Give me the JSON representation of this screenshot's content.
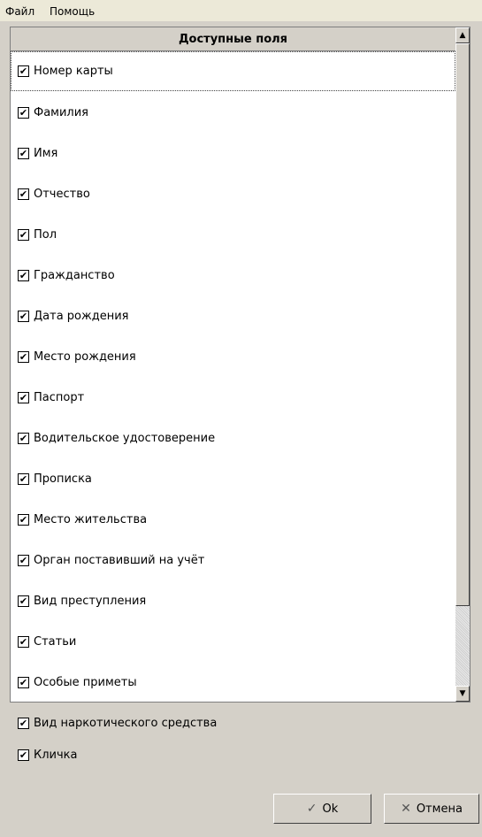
{
  "menu": {
    "file": "Файл",
    "help": "Помощь"
  },
  "list": {
    "header": "Доступные поля",
    "items": [
      {
        "label": "Номер карты",
        "checked": true
      },
      {
        "label": "Фамилия",
        "checked": true
      },
      {
        "label": "Имя",
        "checked": true
      },
      {
        "label": "Отчество",
        "checked": true
      },
      {
        "label": "Пол",
        "checked": true
      },
      {
        "label": "Гражданство",
        "checked": true
      },
      {
        "label": "Дата рождения",
        "checked": true
      },
      {
        "label": "Место рождения",
        "checked": true
      },
      {
        "label": "Паспорт",
        "checked": true
      },
      {
        "label": "Водительское удостоверение",
        "checked": true
      },
      {
        "label": "Прописка",
        "checked": true
      },
      {
        "label": "Место жительства",
        "checked": true
      },
      {
        "label": "Орган поставивший на учёт",
        "checked": true
      },
      {
        "label": "Вид преступления",
        "checked": true
      },
      {
        "label": "Статьи",
        "checked": true
      },
      {
        "label": "Особые приметы",
        "checked": true
      },
      {
        "label": "Вид наркотического средства",
        "checked": true
      },
      {
        "label": "Кличка",
        "checked": true
      }
    ]
  },
  "buttons": {
    "ok": "Ok",
    "cancel": "Отмена"
  },
  "icons": {
    "checkmark": "check-icon",
    "ok": "ok-check-icon",
    "cancel": "cancel-x-icon",
    "up": "arrow-up-icon",
    "down": "arrow-down-icon"
  }
}
